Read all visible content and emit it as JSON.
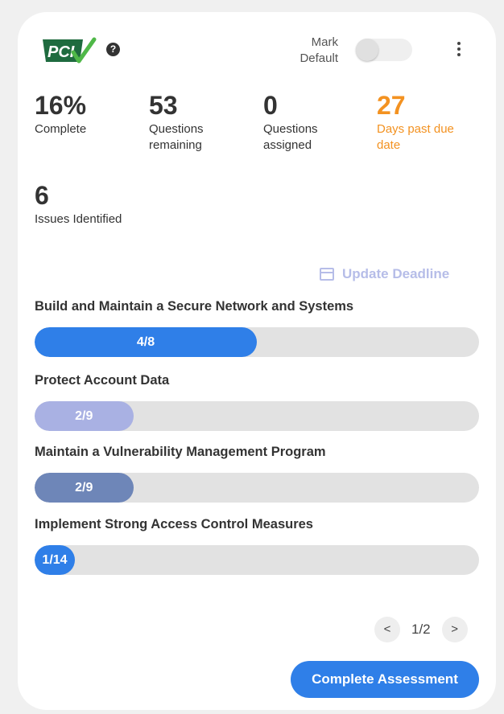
{
  "header": {
    "logo_text": "PCI",
    "help_icon": "question-icon",
    "mark_default_label": "Mark Default",
    "toggle_state": "off"
  },
  "stats": [
    {
      "value": "16%",
      "label": "Complete"
    },
    {
      "value": "53",
      "label": "Questions remaining"
    },
    {
      "value": "0",
      "label": "Questions assigned"
    },
    {
      "value": "27",
      "label": "Days past due date",
      "color": "#f39221"
    },
    {
      "value": "6",
      "label": "Issues Identified"
    }
  ],
  "update_deadline_label": "Update Deadline",
  "sections": [
    {
      "title": "Build and Maintain a Secure Network and Systems",
      "progress_text": "4/8",
      "fraction": 0.5,
      "color": "#2f7fe8"
    },
    {
      "title": "Protect Account Data",
      "progress_text": "2/9",
      "fraction": 0.222,
      "color": "#a9b1e3"
    },
    {
      "title": "Maintain a Vulnerability Management Program",
      "progress_text": "2/9",
      "fraction": 0.222,
      "color": "#6e86b8"
    },
    {
      "title": "Implement Strong Access Control Measures",
      "progress_text": "1/14",
      "fraction": 0.071,
      "color": "#2f7fe8"
    }
  ],
  "pagination": {
    "prev": "<",
    "page": "1/2",
    "next": ">"
  },
  "complete_button_label": "Complete Assessment"
}
